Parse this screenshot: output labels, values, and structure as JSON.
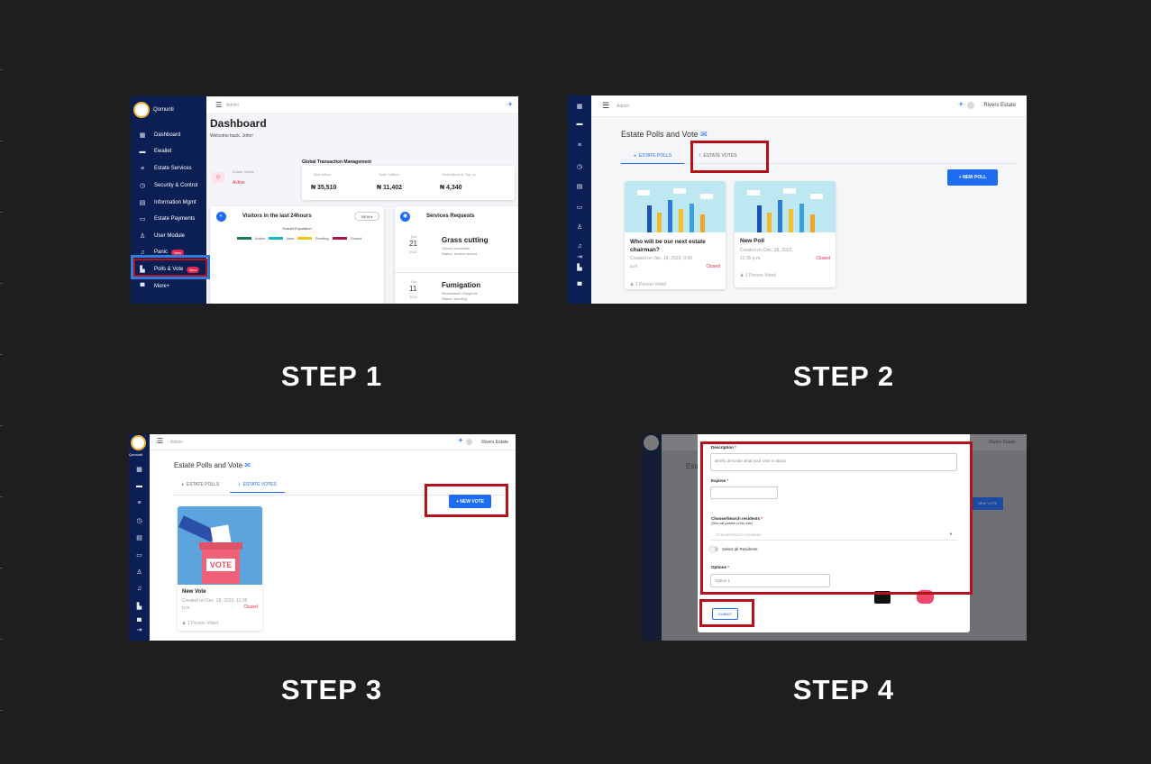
{
  "steps": [
    {
      "label": "STEP 1"
    },
    {
      "label": "STEP 2"
    },
    {
      "label": "STEP 3"
    },
    {
      "label": "STEP 4"
    }
  ],
  "step1": {
    "brand": "Qomunti",
    "topbar_role": "Admin",
    "sidebar": [
      {
        "icon": "grid-icon",
        "glyph": "▦",
        "label": "Dashboard"
      },
      {
        "icon": "wallet-icon",
        "glyph": "▬",
        "label": "Ewallet"
      },
      {
        "icon": "list-icon",
        "glyph": "≡",
        "label": "Estate Services"
      },
      {
        "icon": "clock-icon",
        "glyph": "◷",
        "label": "Security & Control"
      },
      {
        "icon": "file-icon",
        "glyph": "▤",
        "label": "Information Mgmt"
      },
      {
        "icon": "monitor-icon",
        "glyph": "▭",
        "label": "Estate Payments"
      },
      {
        "icon": "user-icon",
        "glyph": "♙",
        "label": "User Module"
      },
      {
        "icon": "bell-icon",
        "glyph": "♫",
        "label": "Panic",
        "badge": "New"
      },
      {
        "icon": "poll-icon",
        "glyph": "▙",
        "label": "Polls & Vote",
        "badge": "New"
      },
      {
        "icon": "more-icon",
        "glyph": "▀",
        "label": "More+"
      }
    ],
    "page_title": "Dashboard",
    "welcome": "Welcome back, John!",
    "gtm_title": "Global Transaction Management",
    "estate_status_label": "Estate Status",
    "estate_status_value": "Active",
    "inflow_label": "Total Inflow",
    "inflow_value": "₦ 35,510",
    "outflow_label": "Total Outflow",
    "outflow_value": "₦ 11,402",
    "admin_topup_label": "Total Admin E-Top up",
    "admin_topup_value": "₦ 4,340",
    "visitors_title": "Visitors in the last 24hours",
    "view_btn": "VIEW",
    "overall_population": "Overall Population",
    "legend": [
      {
        "label": "Active",
        "color": "#1f7a4c"
      },
      {
        "label": "New",
        "color": "#17b6c2"
      },
      {
        "label": "Pending",
        "color": "#f0c419"
      },
      {
        "label": "Closed",
        "color": "#b0134a"
      }
    ],
    "services_title": "Services Requests",
    "services": [
      {
        "month": "Nov",
        "day": "21",
        "year": "2022",
        "title": "Grass cutting",
        "line1": "Victory ezunwhile",
        "line2": "Status: Invoice Issued"
      },
      {
        "month": "Oct",
        "day": "11",
        "year": "2022",
        "title": "Fumigation",
        "line1": "Ifeoluwatobi Gbeghole",
        "line2": "Status: pending"
      }
    ]
  },
  "step2": {
    "topbar_role": "Admin",
    "estate_name": "Rivers Estate",
    "page_title": "Estate Polls and Vote",
    "tab_polls": "ESTATE POLLS",
    "tab_votes": "ESTATE VOTES",
    "new_poll_btn": "+ NEW POLL",
    "cards": [
      {
        "title": "Who will be our next estate chairman?",
        "created": "Created on Jan. 18, 2023, 9:39 a.m.",
        "status": "Closed",
        "voted": "1 Person Voted"
      },
      {
        "title": "New Poll",
        "created": "Created on Dec. 28, 2022, 12:35 p.m.",
        "status": "Closed",
        "voted": "1 Person Voted"
      }
    ]
  },
  "step3": {
    "topbar_role": "Admin",
    "estate_name": "Rivers Estate",
    "brand_short": "Qomunti",
    "page_title": "Estate Polls and Vote",
    "tab_polls": "ESTATE POLLS",
    "tab_votes": "ESTATE VOTES",
    "new_vote_btn": "+ NEW VOTE",
    "vote_sign": "VOTE",
    "card": {
      "title": "New Vote",
      "created": "Created on Dec. 28, 2022, 12:35 p.m.",
      "status": "Closed",
      "voted": "1 Person Voted"
    }
  },
  "step4": {
    "estate_name": "Rivers Estate",
    "description_label": "Description",
    "description_placeholder": "Briefly describe what your Vote is about",
    "expires_label": "Expires",
    "residents_label": "Choose/Search residents",
    "residents_hint": "(Who will partake in this Vote)",
    "residents_placeholder": "Choose/Search residents",
    "select_all": "Select all Residents",
    "options_label": "Options",
    "option_placeholder": "Option 1",
    "submit_btn": "SUBMIT",
    "required_mark": "*",
    "bg_btn": "NEW VOTE",
    "bg_title": "Esta"
  },
  "colors": {
    "highlight_red": "#b4121b",
    "highlight_blue": "#2f7de1",
    "primary": "#1d6cf2",
    "sidebar": "#0c1f54",
    "closed": "#e3264b"
  }
}
